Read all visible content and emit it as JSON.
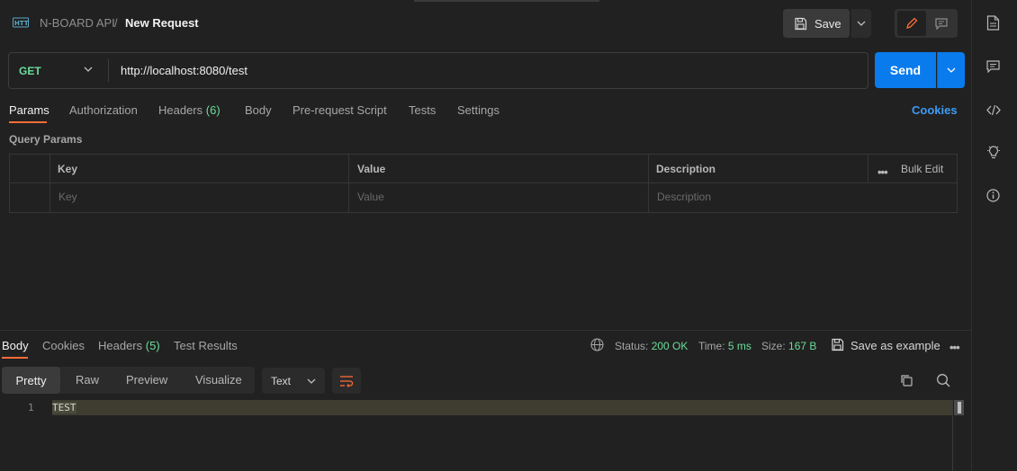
{
  "header": {
    "icon": "http-icon",
    "breadcrumb_parent": "N-BOARD API",
    "breadcrumb_sep": "/",
    "title": "New Request",
    "save_label": "Save"
  },
  "request": {
    "method": "GET",
    "url": "http://localhost:8080/test",
    "send_label": "Send"
  },
  "tabs": [
    {
      "label": "Params"
    },
    {
      "label": "Authorization"
    },
    {
      "label": "Headers",
      "count": "(6)"
    },
    {
      "label": "Body"
    },
    {
      "label": "Pre-request Script"
    },
    {
      "label": "Tests"
    },
    {
      "label": "Settings"
    }
  ],
  "cookies_link": "Cookies",
  "query_params": {
    "label": "Query Params",
    "columns": [
      "Key",
      "Value",
      "Description"
    ],
    "bulk_edit": "Bulk Edit",
    "more": "•••",
    "placeholders": [
      "Key",
      "Value",
      "Description"
    ]
  },
  "response": {
    "tabs": [
      {
        "label": "Body"
      },
      {
        "label": "Cookies"
      },
      {
        "label": "Headers",
        "count": "(5)"
      },
      {
        "label": "Test Results"
      }
    ],
    "status_label": "Status:",
    "status_value": "200 OK",
    "time_label": "Time:",
    "time_value": "5 ms",
    "size_label": "Size:",
    "size_value": "167 B",
    "save_example": "Save as example",
    "more": "•••",
    "view_modes": [
      "Pretty",
      "Raw",
      "Preview",
      "Visualize"
    ],
    "format": "Text",
    "lines": [
      {
        "no": "1",
        "text": "TEST"
      }
    ]
  },
  "colors": {
    "accent_orange": "#ff6c37",
    "send_blue": "#097bed",
    "green": "#6bdd9a",
    "link_blue": "#3d9bf5"
  }
}
